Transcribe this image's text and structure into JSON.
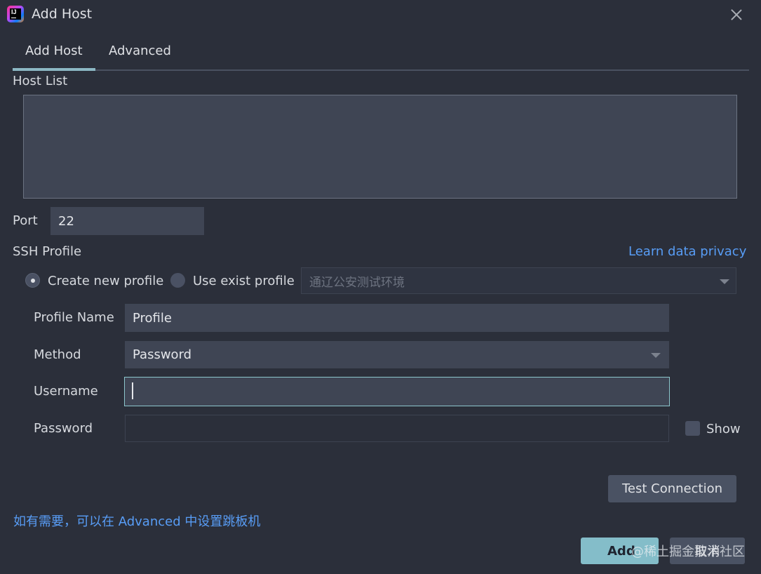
{
  "window": {
    "title": "Add Host"
  },
  "tabs": [
    {
      "label": "Add Host",
      "active": true
    },
    {
      "label": "Advanced",
      "active": false
    }
  ],
  "host_list": {
    "label": "Host List",
    "value": ""
  },
  "port": {
    "label": "Port",
    "value": "22"
  },
  "ssh_profile": {
    "label": "SSH Profile",
    "privacy_link": "Learn data privacy",
    "create_new_label": "Create new profile",
    "use_exist_label": "Use exist profile",
    "existing_profile_selected": "通辽公安测试环境",
    "selected_option": "create_new"
  },
  "form": {
    "profile_name": {
      "label": "Profile Name",
      "value": "Profile"
    },
    "method": {
      "label": "Method",
      "value": "Password"
    },
    "username": {
      "label": "Username",
      "value": ""
    },
    "password": {
      "label": "Password",
      "value": ""
    },
    "show_label": "Show",
    "show_checked": false
  },
  "buttons": {
    "test_connection": "Test Connection",
    "add": "Add",
    "cancel": "取消"
  },
  "hint": "如有需要，可以在 Advanced 中设置跳板机",
  "watermark": "@稀土掘金技术社区",
  "colors": {
    "background": "#2b2f3a",
    "field": "#3f4554",
    "accent": "#8cb8c4",
    "link": "#589df6",
    "primary_button": "#84bdc9"
  },
  "icons": {
    "app": "intellij-idea-icon",
    "close": "close-icon",
    "dropdown": "chevron-down-icon"
  }
}
